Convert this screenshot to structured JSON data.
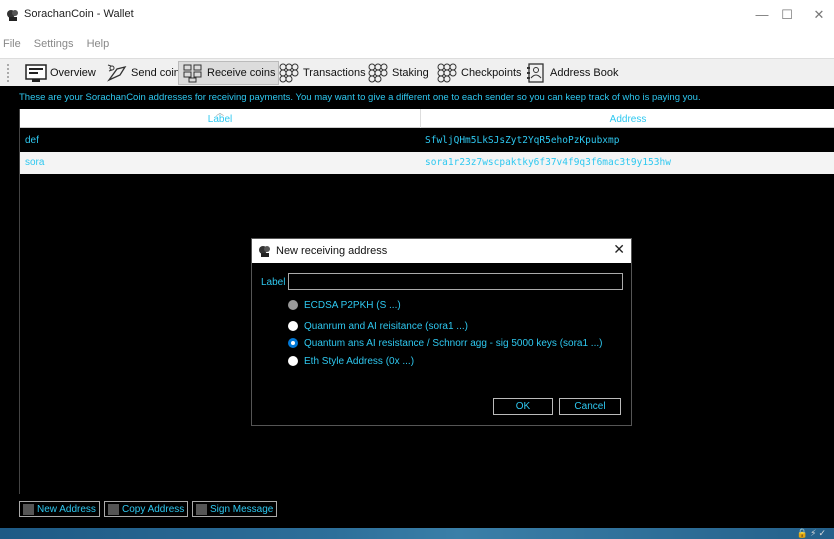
{
  "window": {
    "title": "SorachanCoin - Wallet",
    "minimize": "—",
    "maximize": "☐",
    "close": "✕"
  },
  "menu": [
    "File",
    "Settings",
    "Help"
  ],
  "toolbar": [
    {
      "label": "Overview",
      "icon": "overview-icon"
    },
    {
      "label": "Send coins",
      "icon": "send-coins-icon"
    },
    {
      "label": "Receive coins",
      "icon": "receive-coins-icon",
      "active": true
    },
    {
      "label": "Transactions",
      "icon": "transactions-icon"
    },
    {
      "label": "Staking",
      "icon": "staking-icon"
    },
    {
      "label": "Checkpoints",
      "icon": "checkpoints-icon"
    },
    {
      "label": "Address Book",
      "icon": "address-book-icon"
    }
  ],
  "info_text": "These are your SorachanCoin addresses for receiving payments. You may want to give a different one to each sender so you can keep track of who is paying you.",
  "table": {
    "columns": [
      "Label",
      "Address"
    ],
    "rows": [
      {
        "label": "def",
        "address": "SfwljQHm5LkSJsZyt2YqR5ehoPzKpubxmp"
      },
      {
        "label": "sora",
        "address": "sora1r23z7wscpaktky6f37v4f9q3f6mac3t9y153hw"
      }
    ]
  },
  "bottom_buttons": [
    "New Address",
    "Copy Address",
    "Sign Message"
  ],
  "dialog": {
    "title": "New receiving address",
    "close": "✕",
    "label_caption": "Label",
    "label_value": "",
    "options": [
      {
        "text": "ECDSA P2PKH (S ...)",
        "state": "disabled"
      },
      {
        "text": "Quanrum and AI reisitance (sora1 ...)",
        "state": "normal"
      },
      {
        "text": "Quantum ans AI resistance / Schnorr agg - sig 5000 keys (sora1 ...)",
        "state": "selected"
      },
      {
        "text": "Eth Style Address (0x ...)",
        "state": "normal"
      }
    ],
    "ok": "OK",
    "cancel": "Cancel"
  },
  "colors": {
    "accent_text": "#2ec8f0",
    "background": "#000000",
    "radio_selected": "#0078d7"
  }
}
